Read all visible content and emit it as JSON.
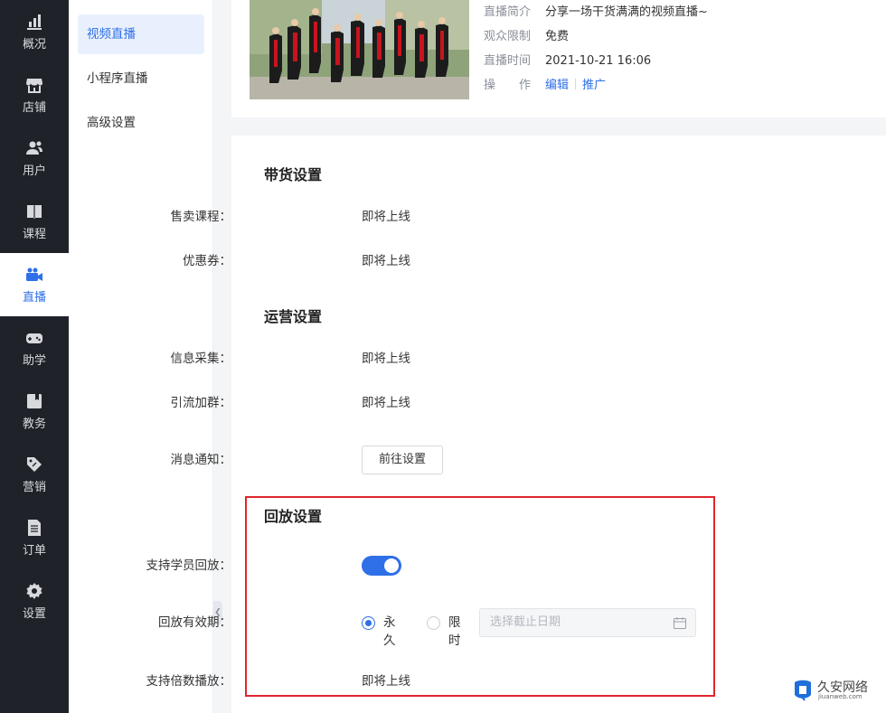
{
  "nav": {
    "items": [
      {
        "label": "概况",
        "icon": "chart-icon"
      },
      {
        "label": "店铺",
        "icon": "store-icon"
      },
      {
        "label": "用户",
        "icon": "users-icon"
      },
      {
        "label": "课程",
        "icon": "book-icon"
      },
      {
        "label": "直播",
        "icon": "video-camera-icon",
        "active": true
      },
      {
        "label": "助学",
        "icon": "gamepad-icon"
      },
      {
        "label": "教务",
        "icon": "notebook-icon"
      },
      {
        "label": "营销",
        "icon": "tag-icon"
      },
      {
        "label": "订单",
        "icon": "document-icon"
      },
      {
        "label": "设置",
        "icon": "gear-icon"
      }
    ]
  },
  "submenu": {
    "items": [
      {
        "label": "视频直播",
        "active": true
      },
      {
        "label": "小程序直播"
      },
      {
        "label": "高级设置"
      }
    ]
  },
  "live_info": {
    "intro_label": "直播简介",
    "intro_value": "分享一场干货满满的视频直播~",
    "audience_label": "观众限制",
    "audience_value": "免费",
    "time_label": "直播时间",
    "time_value": "2021-10-21 16:06",
    "ops_label": "操　　作",
    "edit_link": "编辑",
    "promote_link": "推广"
  },
  "sales": {
    "title": "带货设置",
    "course_label": "售卖课程：",
    "course_value": "即将上线",
    "coupon_label": "优惠券：",
    "coupon_value": "即将上线"
  },
  "ops": {
    "title": "运营设置",
    "collect_label": "信息采集：",
    "collect_value": "即将上线",
    "group_label": "引流加群：",
    "group_value": "即将上线",
    "notify_label": "消息通知：",
    "notify_button": "前往设置"
  },
  "replay": {
    "title": "回放设置",
    "support_label": "支持学员回放：",
    "support_enabled": true,
    "validity_label": "回放有效期：",
    "option_forever": "永久",
    "option_limited": "限时",
    "date_placeholder": "选择截止日期",
    "speed_label": "支持倍数播放：",
    "speed_value": "即将上线"
  },
  "watermark": {
    "name": "久安网络",
    "url": "jiuanweb.com"
  },
  "colors": {
    "accent": "#2f6fe8",
    "nav_bg": "#1f2329",
    "highlight": "#e0262e"
  }
}
